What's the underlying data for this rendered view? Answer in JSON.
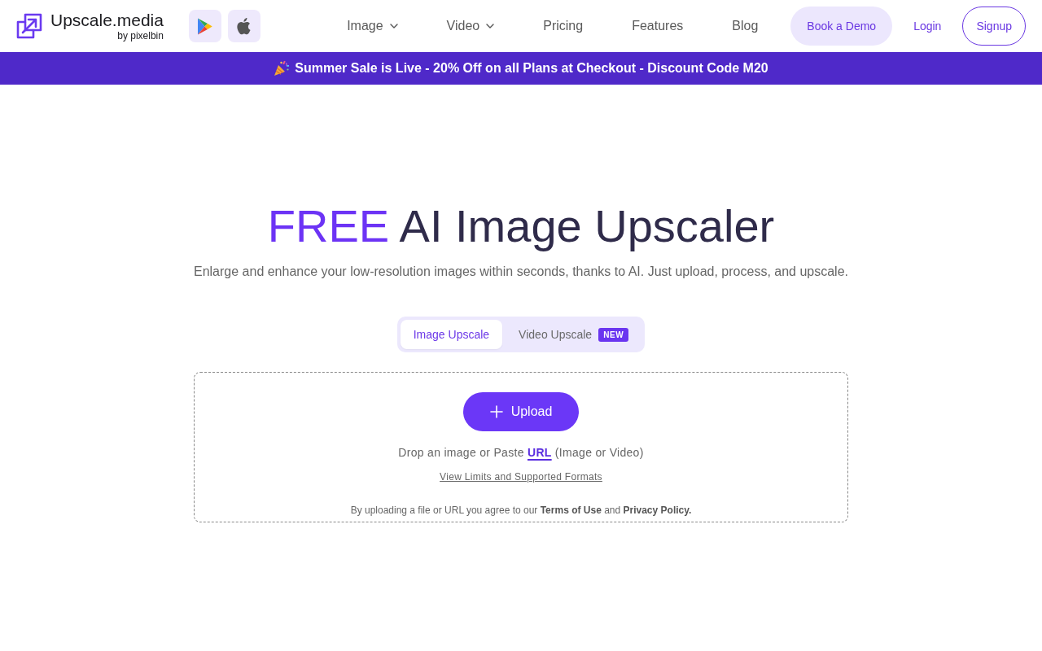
{
  "header": {
    "brand": {
      "name": "Upscale.media",
      "byline": "by pixelbin"
    },
    "nav": [
      {
        "label": "Image",
        "has_menu": true
      },
      {
        "label": "Video",
        "has_menu": true
      },
      {
        "label": "Pricing",
        "has_menu": false
      },
      {
        "label": "Features",
        "has_menu": false
      },
      {
        "label": "Blog",
        "has_menu": false
      }
    ],
    "actions": [
      {
        "label": "Book a Demo",
        "kind": "filled"
      },
      {
        "label": "Login",
        "kind": "text"
      },
      {
        "label": "Signup",
        "kind": "outline"
      }
    ]
  },
  "banner": {
    "text": "Summer Sale is Live - 20% Off on all Plans at Checkout - Discount Code M20"
  },
  "hero": {
    "title_highlight": "FREE",
    "title_rest": "AI Image Upscaler",
    "subtitle": "Enlarge and enhance your low-resolution images within seconds, thanks to AI. Just upload, process, and upscale."
  },
  "tabs": [
    {
      "label": "Image Upscale",
      "selected": true
    },
    {
      "label": "Video Upscale",
      "selected": false,
      "badge": "NEW"
    }
  ],
  "dropzone": {
    "button": "Upload",
    "prompt_before": "Drop an image or Paste",
    "url_link": "URL",
    "prompt_after": "(Image or Video)",
    "limits_link": "View Limits and Supported Formats",
    "terms": "By uploading a file or URL you agree to our **Terms of Use** and **Privacy Policy.**"
  }
}
